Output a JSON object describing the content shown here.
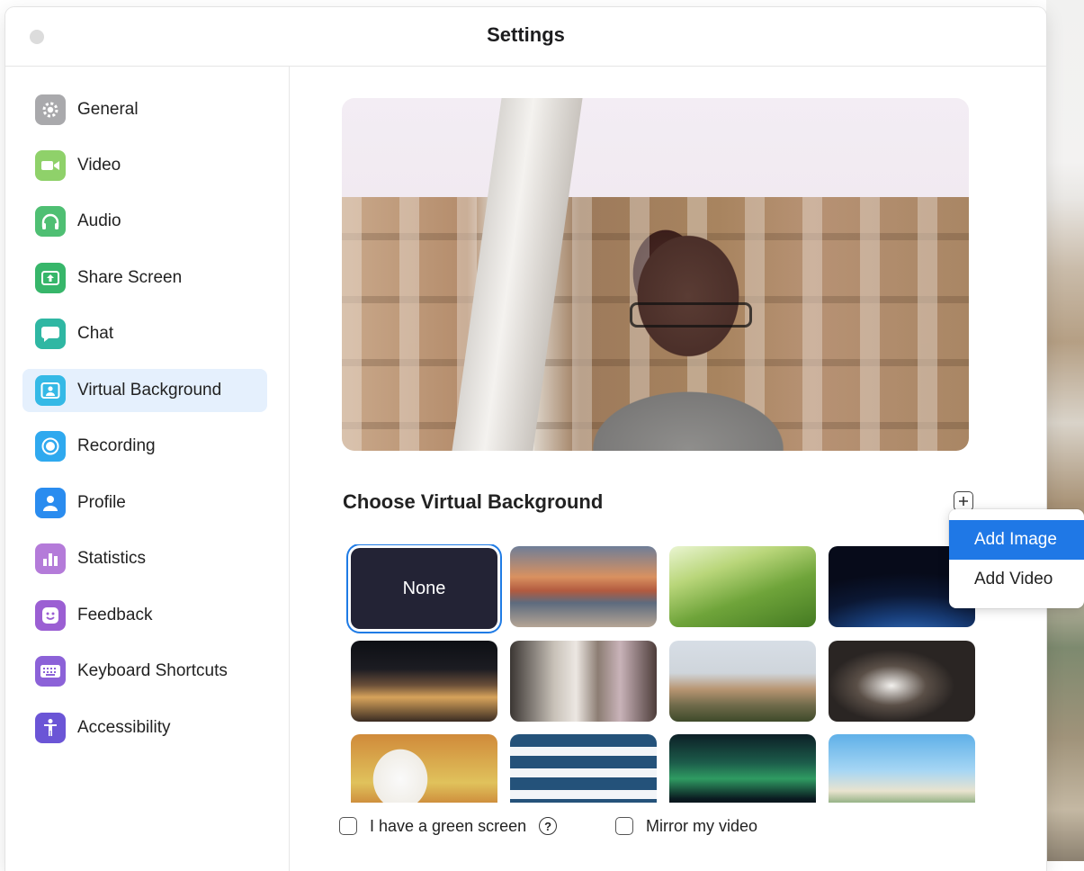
{
  "window": {
    "title": "Settings"
  },
  "sidebar": {
    "items": [
      {
        "label": "General",
        "icon": "gear-icon",
        "color": "#a9a9ac"
      },
      {
        "label": "Video",
        "icon": "video-camera-icon",
        "color": "#8fd16a"
      },
      {
        "label": "Audio",
        "icon": "headphones-icon",
        "color": "#4fbf73"
      },
      {
        "label": "Share Screen",
        "icon": "share-screen-icon",
        "color": "#37b66a"
      },
      {
        "label": "Chat",
        "icon": "chat-bubble-icon",
        "color": "#2fb7a3"
      },
      {
        "label": "Virtual Background",
        "icon": "virtual-background-icon",
        "color": "#35b9e6",
        "active": true
      },
      {
        "label": "Recording",
        "icon": "record-icon",
        "color": "#2fa9ef"
      },
      {
        "label": "Profile",
        "icon": "person-icon",
        "color": "#2a8cef"
      },
      {
        "label": "Statistics",
        "icon": "bar-chart-icon",
        "color": "#b47bd9"
      },
      {
        "label": "Feedback",
        "icon": "smiley-icon",
        "color": "#9b5fd3"
      },
      {
        "label": "Keyboard Shortcuts",
        "icon": "keyboard-icon",
        "color": "#8c62d8"
      },
      {
        "label": "Accessibility",
        "icon": "accessibility-icon",
        "color": "#6b55d6"
      }
    ]
  },
  "main": {
    "section_title": "Choose Virtual Background",
    "none_label": "None",
    "backgrounds": [
      "golden-gate-bridge",
      "grass",
      "earth-from-space",
      "building-at-night",
      "people-group",
      "acropolis",
      "cat",
      "egg-snack",
      "text-slide",
      "northern-lights",
      "tropical-beach"
    ],
    "green_screen_label": "I have a green screen",
    "mirror_label": "Mirror my video",
    "green_screen_checked": false,
    "mirror_checked": false
  },
  "add_menu": {
    "items": [
      {
        "label": "Add Image",
        "highlighted": true
      },
      {
        "label": "Add Video",
        "highlighted": false
      }
    ]
  },
  "colors": {
    "accent": "#1f78e6",
    "active_nav_bg": "#e5f0fd",
    "none_tile": "#232335"
  }
}
